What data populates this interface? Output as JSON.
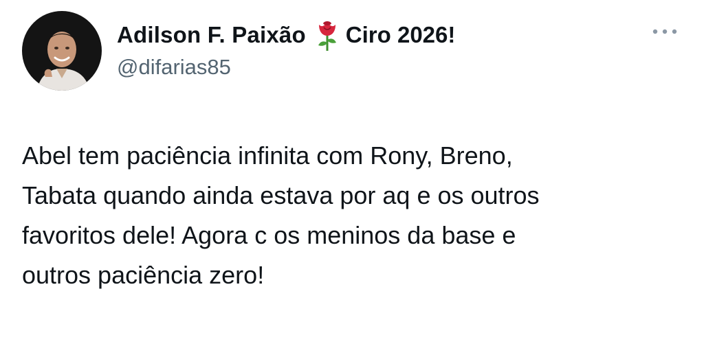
{
  "tweet": {
    "author": {
      "display_name": "Adilson F. Paixão",
      "name_emoji": "rose-icon",
      "name_suffix": "Ciro 2026!",
      "handle": "@difarias85",
      "avatar": "avatar-photo"
    },
    "more_icon": "more-dots-icon",
    "text": "Abel tem paciência infinita com Rony, Breno,\nTabata quando ainda estava por aq e os outros\nfavoritos dele! Agora c os meninos da base e\noutros paciência zero!"
  },
  "colors": {
    "text_primary": "#0f1419",
    "text_secondary": "#536471",
    "rose": "#d7263d"
  }
}
